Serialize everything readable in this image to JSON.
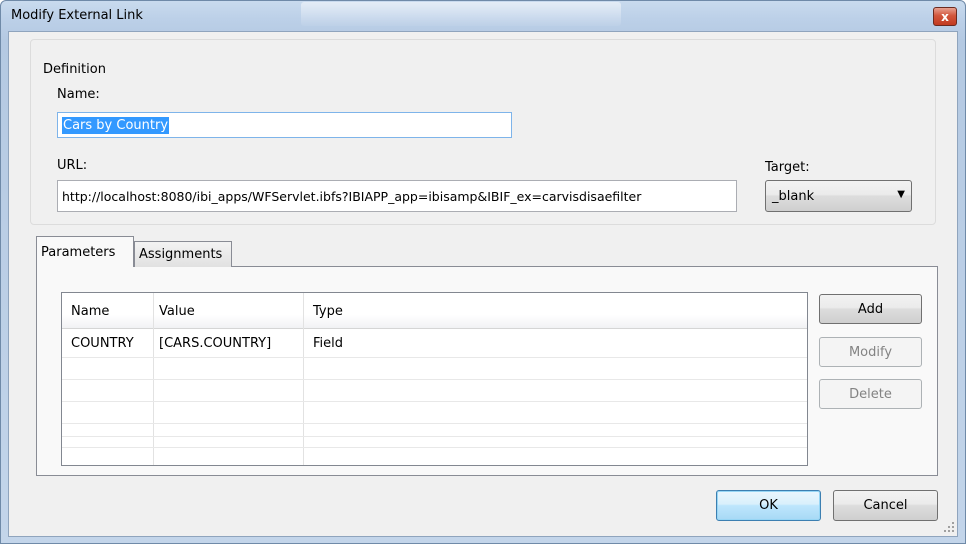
{
  "window": {
    "title": "Modify External Link",
    "close_glyph": "x"
  },
  "definition": {
    "legend": "Definition",
    "name_label": "Name:",
    "name_value": "Cars by Country",
    "url_label": "URL:",
    "url_value": "http://localhost:8080/ibi_apps/WFServlet.ibfs?IBIAPP_app=ibisamp&IBIF_ex=carvisdisaefilter",
    "target_label": "Target:",
    "target_value": "_blank"
  },
  "tabs": [
    {
      "label": "Parameters",
      "active": true
    },
    {
      "label": "Assignments",
      "active": false
    }
  ],
  "grid": {
    "columns": [
      "Name",
      "Value",
      "Type"
    ],
    "rows": [
      [
        "COUNTRY",
        "[CARS.COUNTRY]",
        "Field"
      ]
    ]
  },
  "side_buttons": {
    "add": "Add",
    "modify": "Modify",
    "delete": "Delete"
  },
  "footer": {
    "ok": "OK",
    "cancel": "Cancel"
  },
  "colors": {
    "selection": "#3399ff",
    "close_button": "#c23a20",
    "default_button_border": "#3c7fb1"
  },
  "icons": {
    "close": "close-icon",
    "dropdown": "chevron-down-icon",
    "resize": "resize-grip-icon"
  }
}
